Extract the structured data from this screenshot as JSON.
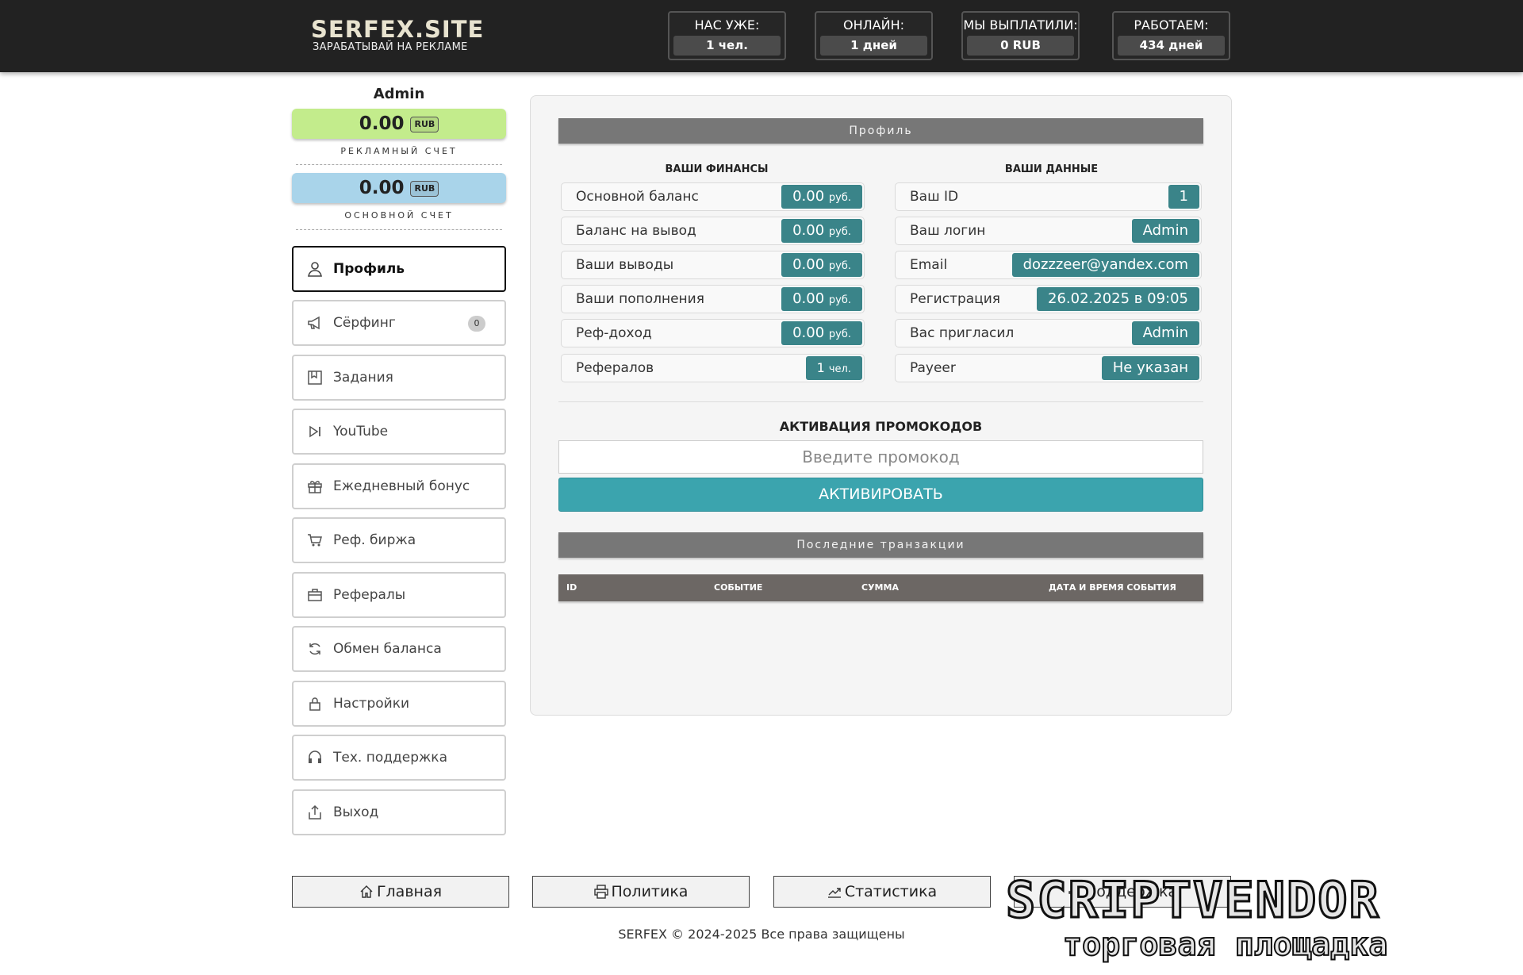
{
  "header": {
    "logo_title": "SERFEX.SITE",
    "logo_subtitle": "ЗАРАБАТЫВАЙ НА РЕКЛАМЕ",
    "stats": [
      {
        "label": "НАС УЖЕ:",
        "value": "1 чел."
      },
      {
        "label": "ОНЛАЙН:",
        "value": "1 дней"
      },
      {
        "label": "МЫ ВЫПЛАТИЛИ:",
        "value": "0 RUB"
      },
      {
        "label": "РАБОТАЕМ:",
        "value": "434 дней"
      }
    ]
  },
  "sidebar": {
    "username": "Admin",
    "ad_balance": {
      "amount": "0.00",
      "currency": "RUB",
      "label": "РЕКЛАМНЫЙ СЧЕТ",
      "color": "#c3ec8c"
    },
    "main_balance": {
      "amount": "0.00",
      "currency": "RUB",
      "label": "ОСНОВНОЙ СЧЕТ",
      "color": "#a9d4ea"
    },
    "menu": [
      {
        "label": "Профиль",
        "icon": "user-icon",
        "active": true
      },
      {
        "label": "Сёрфинг",
        "icon": "megaphone-icon",
        "badge": "0"
      },
      {
        "label": "Задания",
        "icon": "bookmark-icon"
      },
      {
        "label": "YouTube",
        "icon": "play-skip-icon"
      },
      {
        "label": "Ежедневный бонус",
        "icon": "gift-icon"
      },
      {
        "label": "Реф. биржа",
        "icon": "cart-icon"
      },
      {
        "label": "Рефералы",
        "icon": "briefcase-icon"
      },
      {
        "label": "Обмен баланса",
        "icon": "refresh-icon"
      },
      {
        "label": "Настройки",
        "icon": "lock-icon"
      },
      {
        "label": "Тех. поддержка",
        "icon": "headset-icon"
      },
      {
        "label": "Выход",
        "icon": "exit-icon"
      }
    ]
  },
  "main": {
    "profile_header": "Профиль",
    "finances_title": "ВАШИ ФИНАНСЫ",
    "data_title": "ВАШИ ДАННЫЕ",
    "finances": [
      {
        "label": "Основной баланс",
        "value": "0.00",
        "unit": "руб."
      },
      {
        "label": "Баланс на вывод",
        "value": "0.00",
        "unit": "руб."
      },
      {
        "label": "Ваши выводы",
        "value": "0.00",
        "unit": "руб."
      },
      {
        "label": "Ваши пополнения",
        "value": "0.00",
        "unit": "руб."
      },
      {
        "label": "Реф-доход",
        "value": "0.00",
        "unit": "руб."
      },
      {
        "label": "Рефералов",
        "value": "1",
        "unit": "чел."
      }
    ],
    "user_data": [
      {
        "label": "Ваш ID",
        "value": "1"
      },
      {
        "label": "Ваш логин",
        "value": "Admin"
      },
      {
        "label": "Email",
        "value": "dozzzeer@yandex.com"
      },
      {
        "label": "Регистрация",
        "value": "26.02.2025 в 09:05"
      },
      {
        "label": "Вас пригласил",
        "value": "Admin"
      },
      {
        "label": "Payeer",
        "value": "Не указан"
      }
    ],
    "promo_title": "АКТИВАЦИЯ ПРОМОКОДОВ",
    "promo_placeholder": "Введите промокод",
    "promo_button": "АКТИВИРОВАТЬ",
    "transactions_header": "Последние транзакции",
    "table_columns": [
      "ID",
      "СОБЫТИЕ",
      "СУММА",
      "ДАТА И ВРЕМЯ СОБЫТИЯ"
    ]
  },
  "footer": {
    "buttons": [
      {
        "label": "Главная",
        "icon": "home-icon"
      },
      {
        "label": "Политика",
        "icon": "printer-icon"
      },
      {
        "label": "Статистика",
        "icon": "chart-line-icon"
      },
      {
        "label": "Поддержка",
        "icon": "support-icon"
      }
    ],
    "copyright": "SERFEX © 2024-2025 Все права защищены"
  },
  "watermark": {
    "title": "SCRIPTVENDOR",
    "subtitle": "торговая площадка"
  },
  "colors": {
    "header_bg": "#222222",
    "accent_teal": "#3a8489",
    "button_teal": "#3ba4ae",
    "section_gray": "#777777"
  }
}
